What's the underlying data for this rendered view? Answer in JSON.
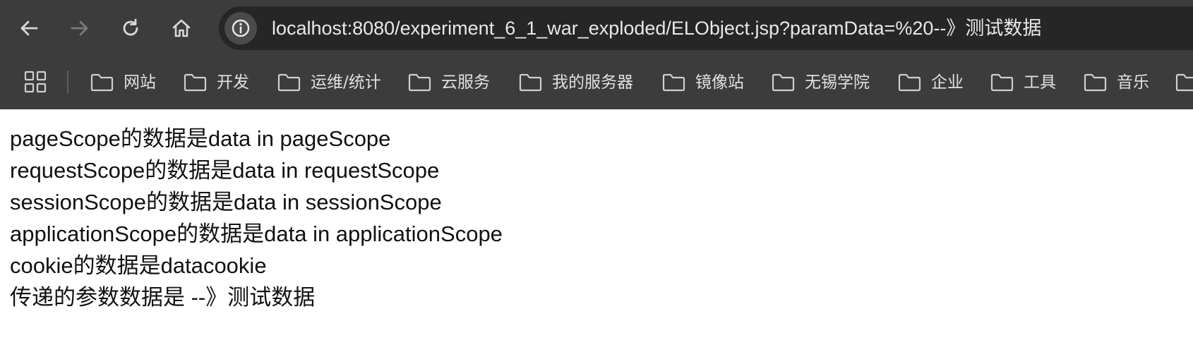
{
  "browser": {
    "url": "localhost:8080/experiment_6_1_war_exploded/ELObject.jsp?paramData=%20--》测试数据",
    "icons": {
      "back": "arrow-left-icon",
      "forward": "arrow-right-icon",
      "reload": "reload-icon",
      "home": "home-icon",
      "site_info": "info-circle-icon",
      "apps": "apps-grid-icon",
      "folder": "folder-icon"
    }
  },
  "bookmarks": [
    {
      "label": "网站"
    },
    {
      "label": "开发"
    },
    {
      "label": "运维/统计"
    },
    {
      "label": "云服务"
    },
    {
      "label": "我的服务器"
    },
    {
      "label": "镜像站"
    },
    {
      "label": "无锡学院"
    },
    {
      "label": "企业"
    },
    {
      "label": "工具"
    },
    {
      "label": "音乐"
    },
    {
      "label": ""
    }
  ],
  "page": {
    "lines": [
      "pageScope的数据是data in pageScope",
      "requestScope的数据是data in requestScope",
      "sessionScope的数据是data in sessionScope",
      "applicationScope的数据是data in applicationScope",
      "cookie的数据是datacookie",
      "传递的参数数据是 --》测试数据"
    ]
  }
}
